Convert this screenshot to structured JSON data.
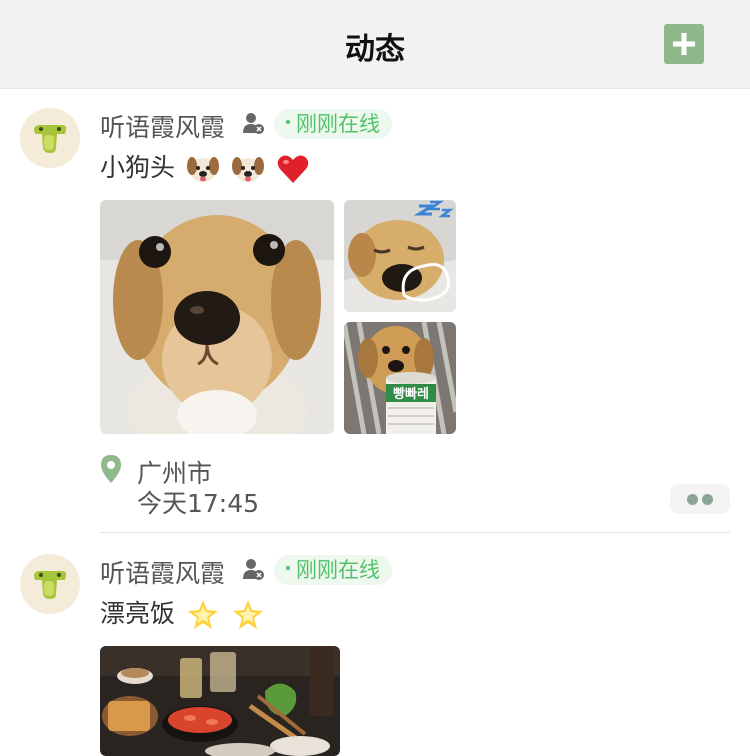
{
  "header": {
    "title": "动态",
    "add_icon": "plus-icon",
    "accent_color": "#8fb98a"
  },
  "posts": [
    {
      "username": "听语霞风霞",
      "online_status": "刚刚在线",
      "text": "小狗头",
      "emojis": [
        "dog-face",
        "dog-face",
        "red-heart"
      ],
      "photos": [
        "puppy-closeup",
        "sleeping-puppy",
        "puppy-with-cup"
      ],
      "location": "广州市",
      "time": "今天17:45"
    },
    {
      "username": "听语霞风霞",
      "online_status": "刚刚在线",
      "text": "漂亮饭",
      "emojis": [
        "glowing-star",
        "glowing-star"
      ],
      "photos": [
        "food-table"
      ]
    }
  ],
  "photo_sticker_text": "빵빠레"
}
